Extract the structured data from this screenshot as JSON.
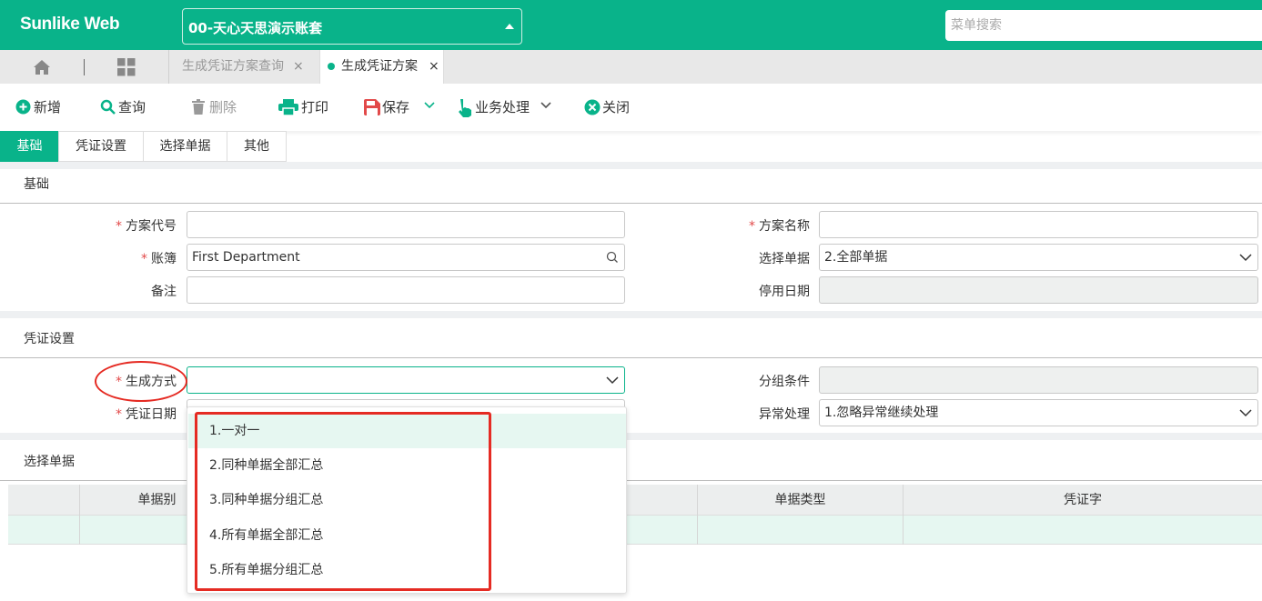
{
  "app": {
    "brand": "Sunlike Web",
    "account": "00-天心天思演示账套",
    "menu_search_placeholder": "菜单搜索"
  },
  "tabs": [
    {
      "label": "生成凭证方案查询",
      "active": false
    },
    {
      "label": "生成凭证方案",
      "active": true
    }
  ],
  "toolbar": {
    "add": "新增",
    "query": "查询",
    "delete": "删除",
    "print": "打印",
    "save": "保存",
    "business": "业务处理",
    "close": "关闭"
  },
  "subtabs": [
    "基础",
    "凭证设置",
    "选择单据",
    "其他"
  ],
  "sections": {
    "basic": {
      "title": "基础",
      "plan_code_label": "方案代号",
      "plan_code_value": "",
      "plan_name_label": "方案名称",
      "plan_name_value": "",
      "ledger_label": "账簿",
      "ledger_value": "First Department",
      "select_doc_label": "选择单据",
      "select_doc_value": "2.全部单据",
      "remark_label": "备注",
      "remark_value": "",
      "disable_date_label": "停用日期",
      "disable_date_value": ""
    },
    "voucher": {
      "title": "凭证设置",
      "gen_method_label": "生成方式",
      "gen_method_value": "",
      "group_cond_label": "分组条件",
      "group_cond_value": "",
      "voucher_date_label": "凭证日期",
      "exception_label": "异常处理",
      "exception_value": "1.忽略异常继续处理"
    },
    "docs": {
      "title": "选择单据",
      "columns": [
        "单据别",
        "单据类型",
        "凭证字"
      ]
    }
  },
  "dropdown_options": [
    "1.一对一",
    "2.同种单据全部汇总",
    "3.同种单据分组汇总",
    "4.所有单据全部汇总",
    "5.所有单据分组汇总"
  ],
  "colors": {
    "primary": "#09b38a",
    "highlight": "#e6f7f1",
    "annotation": "#e52b23",
    "required": "#e24a4a"
  }
}
